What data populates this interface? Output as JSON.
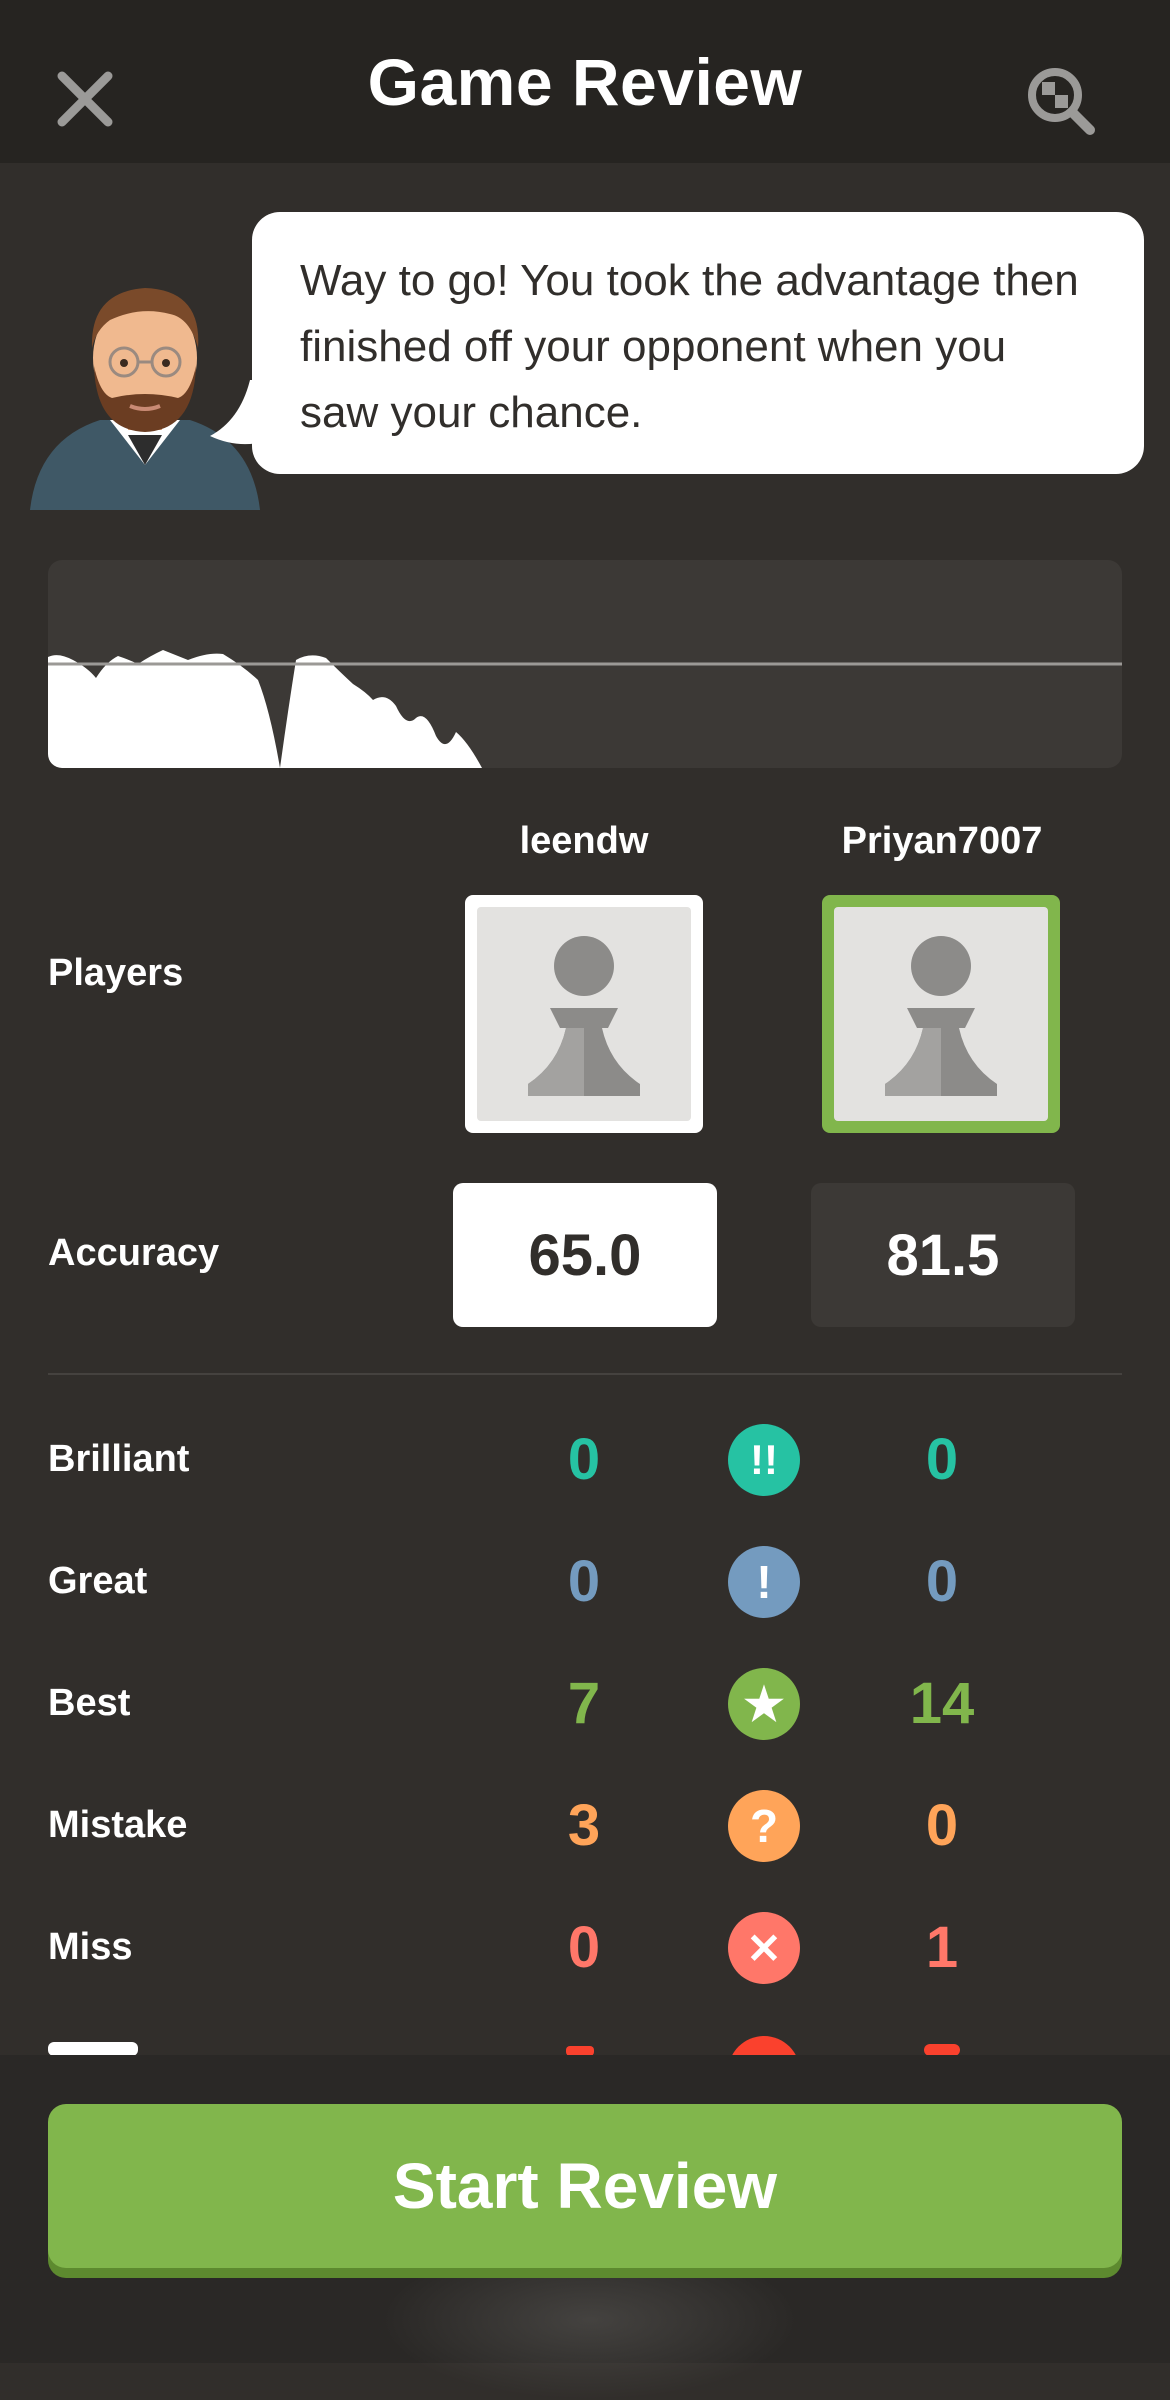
{
  "header": {
    "title": "Game Review",
    "close_icon": "close-icon",
    "search_icon": "analysis-search-icon"
  },
  "coach": {
    "message": "Way to go! You took the advantage then finished off your opponent when you saw your chance."
  },
  "players": {
    "label": "Players",
    "white": {
      "name": "leendw",
      "avatar": "pawn-avatar-icon"
    },
    "black": {
      "name": "Priyan7007",
      "avatar": "pawn-avatar-icon"
    }
  },
  "accuracy": {
    "label": "Accuracy",
    "white": "65.0",
    "black": "81.5"
  },
  "classifications": [
    {
      "label": "Brilliant",
      "white": "0",
      "black": "0",
      "icon": "brilliant-icon",
      "color": "#26c2a3",
      "symbol": "!!"
    },
    {
      "label": "Great",
      "white": "0",
      "black": "0",
      "icon": "great-icon",
      "color": "#749bbf",
      "symbol": "!"
    },
    {
      "label": "Best",
      "white": "7",
      "black": "14",
      "icon": "best-star-icon",
      "color": "#81b64c",
      "symbol": "★"
    },
    {
      "label": "Mistake",
      "white": "3",
      "black": "0",
      "icon": "mistake-icon",
      "color": "#ffa459",
      "symbol": "?"
    },
    {
      "label": "Miss",
      "white": "0",
      "black": "1",
      "icon": "miss-icon",
      "color": "#ff7769",
      "symbol": "✕"
    }
  ],
  "footer": {
    "start_label": "Start Review"
  },
  "colors": {
    "background": "#312e2b",
    "header": "#262421",
    "accent_green": "#81b64c"
  }
}
